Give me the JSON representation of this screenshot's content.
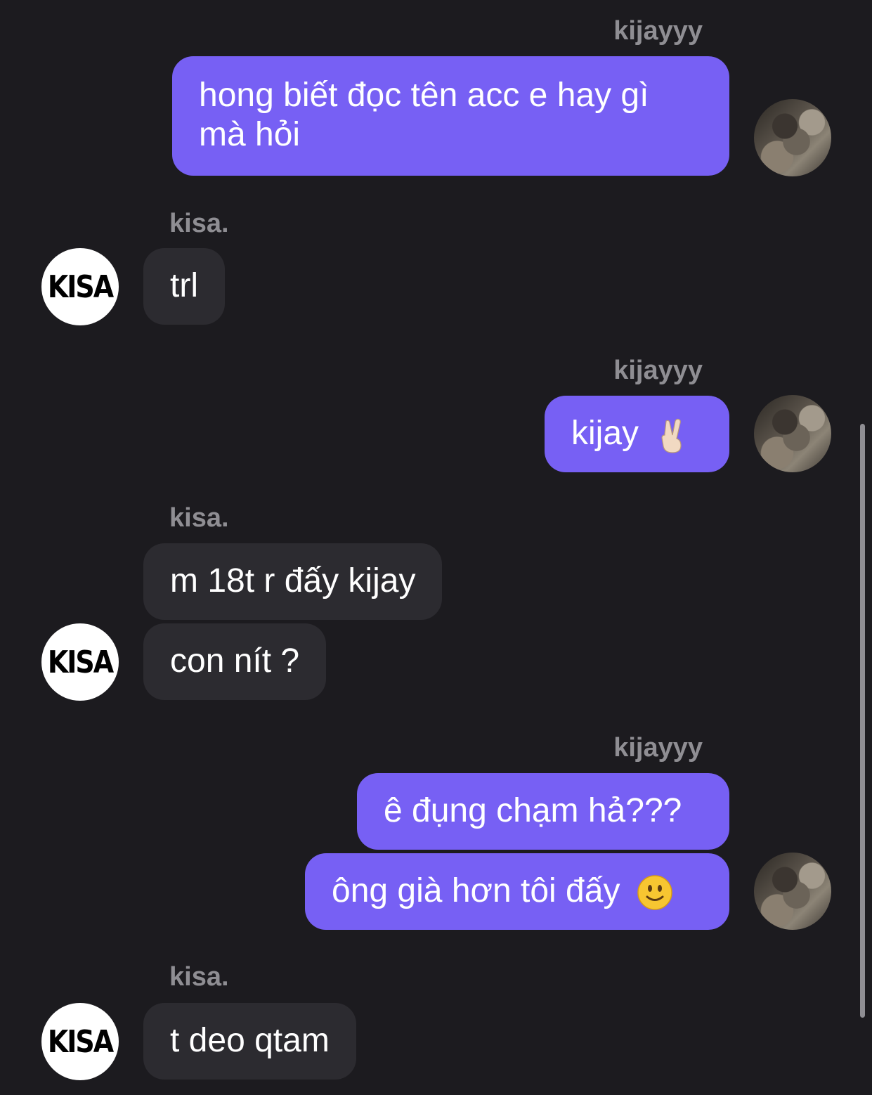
{
  "conversation": {
    "messages": [
      {
        "sender": "kijayyy",
        "text": "hong biết đọc tên acc e hay gì mà hỏi"
      },
      {
        "sender": "kisa.",
        "text": "trl"
      },
      {
        "sender": "kijayyy",
        "text": "kijay"
      },
      {
        "sender": "kisa.",
        "text": "m 18t r đấy kijay"
      },
      {
        "sender": "kisa.",
        "text": "con nít ?"
      },
      {
        "sender": "kijayyy",
        "text": "ê đụng chạm hả???"
      },
      {
        "sender": "kijayyy",
        "text": "ông già hơn tôi đấy"
      },
      {
        "sender": "kisa.",
        "text": "t deo qtam"
      }
    ],
    "self_name": "kijayyy",
    "other_name": "kisa.",
    "other_avatar_text": "KISA",
    "emojis": [
      "victory-hand-icon",
      "slightly-smiling-face-icon"
    ]
  },
  "colors": {
    "background": "#1c1b1f",
    "outgoing_bubble": "#7760f4",
    "incoming_bubble": "#2c2b30",
    "sender_name": "#8f8e93"
  }
}
